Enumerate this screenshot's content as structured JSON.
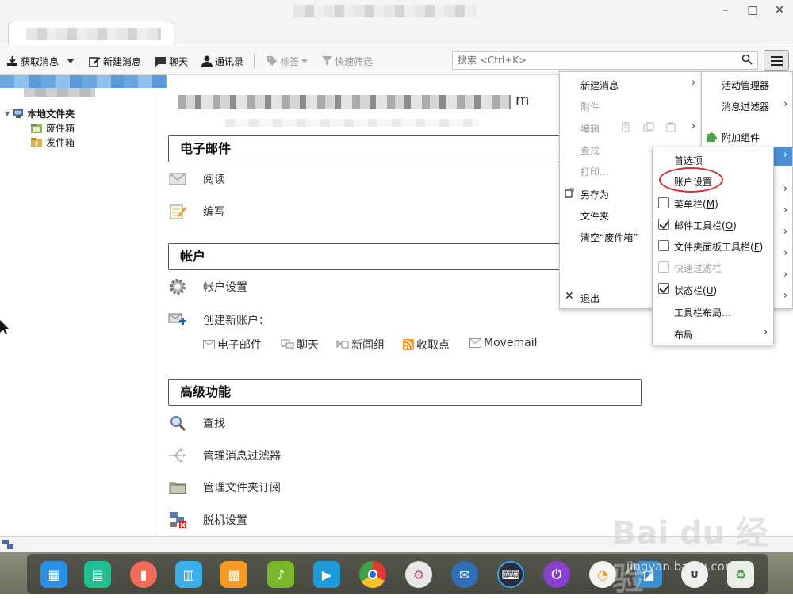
{
  "window": {
    "minimize": "–",
    "maximize": "□",
    "close": "✕"
  },
  "toolbar": {
    "get_messages": "获取消息",
    "new_message": "新建消息",
    "chat": "聊天",
    "address_book": "通讯录",
    "tag": "标签",
    "quick_filter": "快速筛选",
    "search_placeholder": "搜索 <Ctrl+K>"
  },
  "sidebar": {
    "local_folders": "本地文件夹",
    "items": [
      {
        "label": "废件箱"
      },
      {
        "label": "发件箱"
      }
    ]
  },
  "main": {
    "account_title_tail": "m",
    "sections": {
      "email": "电子邮件",
      "accounts": "帐户",
      "advanced": "高级功能"
    },
    "email_items": {
      "read": "阅读",
      "compose": "编写"
    },
    "account_items": {
      "settings": "帐户设置",
      "create": "创建新账户："
    },
    "create_types": [
      {
        "label": "电子邮件"
      },
      {
        "label": "聊天"
      },
      {
        "label": "新闻组"
      },
      {
        "label": "收取点"
      },
      {
        "label": "Movemail"
      }
    ],
    "advanced_items": {
      "search": "查找",
      "filters": "管理消息过滤器",
      "subscribe": "管理文件夹订阅",
      "offline": "脱机设置"
    }
  },
  "app_menu": {
    "new_message": "新建消息",
    "attachment": "附件",
    "edit": "编辑",
    "find": "查找",
    "print": "打印…",
    "save_as": "另存为",
    "folder": "文件夹",
    "empty_trash": "清空“废件箱”",
    "quit": "退出"
  },
  "tools_menu": {
    "activity_manager": "活动管理器",
    "message_filters": "消息过滤器",
    "addons": "附加组件"
  },
  "prefs_menu": {
    "preferences": "首选项",
    "account_settings": "账户设置",
    "menubar": {
      "label": "菜单栏",
      "key": "M",
      "checked": false
    },
    "mail_toolbar": {
      "label": "邮件工具栏",
      "key": "O",
      "checked": true
    },
    "folder_toolbar": {
      "label": "文件夹面板工具栏",
      "key": "F",
      "checked": false
    },
    "quick_filter_bar": {
      "label": "快速过滤栏",
      "checked": false,
      "disabled": true
    },
    "statusbar": {
      "label": "状态栏",
      "key": "U",
      "checked": true
    },
    "toolbar_layout": "工具栏布局…",
    "layout": "布局"
  },
  "watermark": {
    "brand": "Bai du 经验",
    "url": "jingyan.baidu.com"
  },
  "colors": {
    "accent_blue": "#4a90d9",
    "highlight_ring": "#d0303a"
  }
}
